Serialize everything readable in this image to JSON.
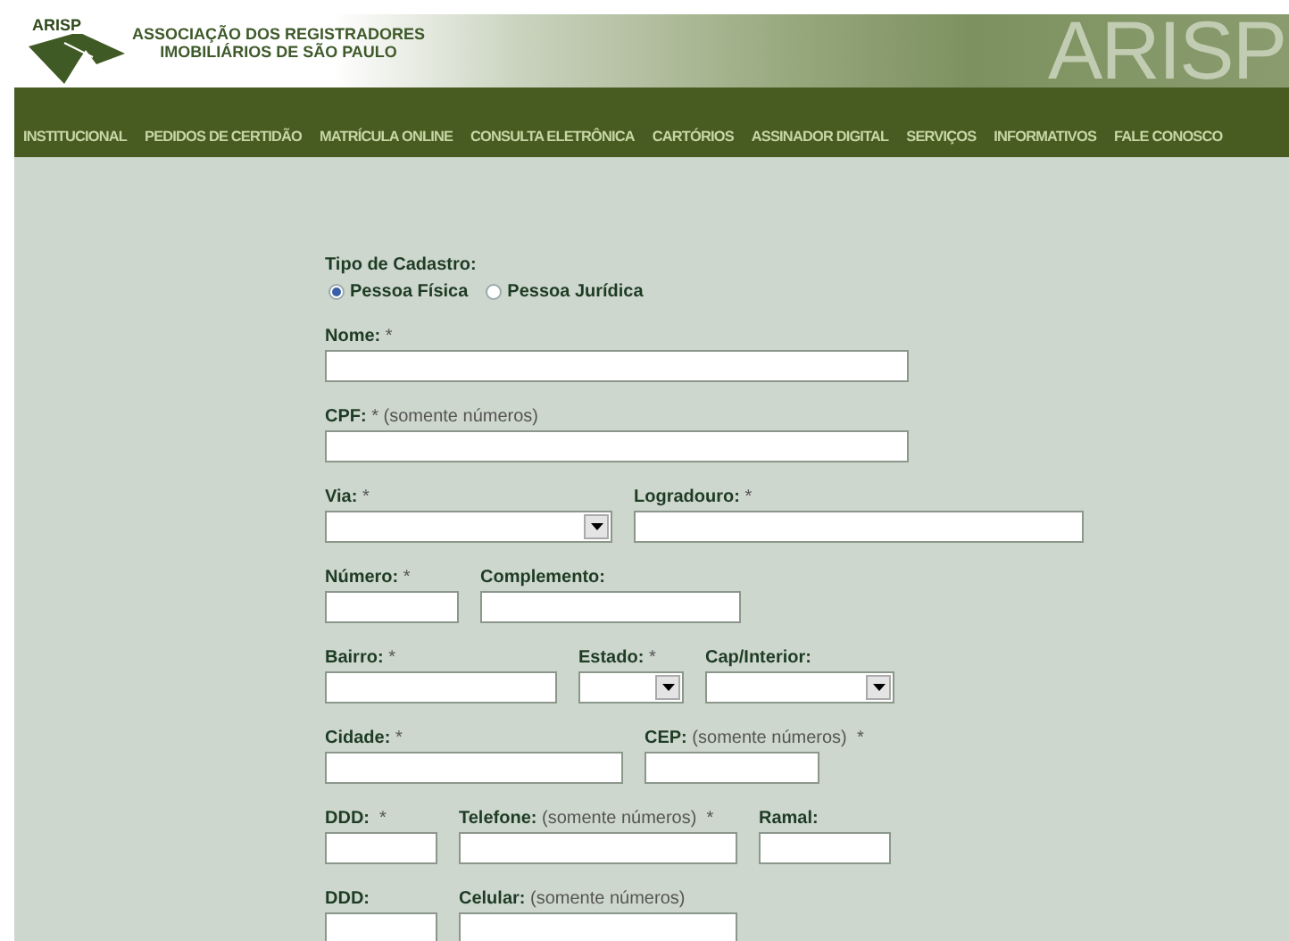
{
  "header": {
    "logo_mark": "ARISP",
    "org_name_lines": [
      "ASSOCIAÇÃO DOS REGISTRADORES",
      "IMOBILIÁRIOS DE SÃO PAULO"
    ],
    "banner_text": "ARISP"
  },
  "nav": [
    "INSTITUCIONAL",
    "PEDIDOS DE CERTIDÃO",
    "MATRÍCULA ONLINE",
    "CONSULTA ELETRÔNICA",
    "CARTÓRIOS",
    "ASSINADOR DIGITAL",
    "SERVIÇOS",
    "INFORMATIVOS",
    "FALE CONOSCO"
  ],
  "form": {
    "type_label": "Tipo de Cadastro:",
    "type_options": [
      {
        "label": "Pessoa Física",
        "selected": true
      },
      {
        "label": "Pessoa Jurídica",
        "selected": false
      }
    ],
    "rows": [
      [
        {
          "label": "**Nome:** *",
          "kind": "text"
        }
      ],
      [
        {
          "label": "**CPF:** * (somente números)",
          "kind": "text"
        }
      ],
      [
        {
          "label": "**Via:** *",
          "kind": "select"
        },
        {
          "label": "**Logradouro:** *",
          "kind": "text"
        }
      ],
      [
        {
          "label": "**Número:** *",
          "kind": "text"
        },
        {
          "label": "**Complemento:**",
          "kind": "text"
        }
      ],
      [
        {
          "label": "**Bairro:** *",
          "kind": "text"
        },
        {
          "label": "**Estado:** *",
          "kind": "select"
        },
        {
          "label": "**Cap/Interior:**",
          "kind": "select"
        }
      ],
      [
        {
          "label": "**Cidade:** *",
          "kind": "text"
        },
        {
          "label": "**CEP:** (somente números)  *",
          "kind": "text"
        }
      ],
      [
        {
          "label": "**DDD:**  *",
          "kind": "text"
        },
        {
          "label": "**Telefone:** (somente números)  *",
          "kind": "text"
        },
        {
          "label": "**Ramal:**",
          "kind": "text"
        }
      ],
      [
        {
          "label": "**DDD:**",
          "kind": "text"
        },
        {
          "label": "**Celular:** (somente números)",
          "kind": "text"
        }
      ]
    ]
  }
}
